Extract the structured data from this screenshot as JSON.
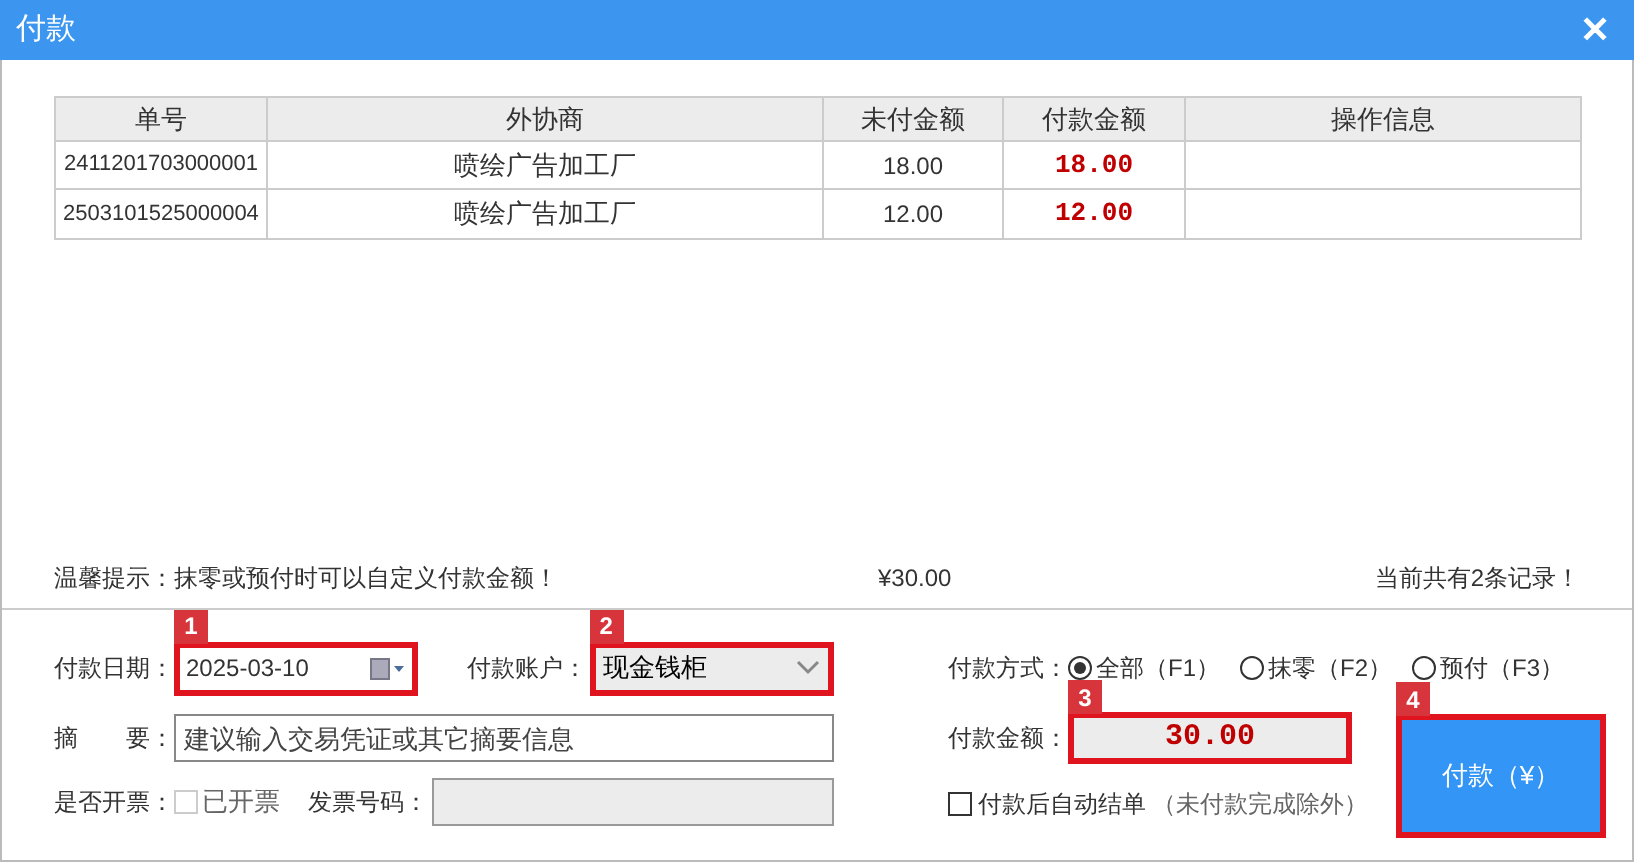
{
  "window": {
    "title": "付款",
    "close": "✕"
  },
  "table": {
    "columns": [
      "单号",
      "外协商",
      "未付金额",
      "付款金额",
      "操作信息"
    ],
    "rows": [
      {
        "cells": [
          "2411201703000001",
          "喷绘广告加工厂",
          "18.00",
          "18.00",
          ""
        ]
      },
      {
        "cells": [
          "2503101525000004",
          "喷绘广告加工厂",
          "12.00",
          "12.00",
          ""
        ]
      }
    ]
  },
  "summary": {
    "hint": "温馨提示：抹零或预付时可以自定义付款金额！",
    "total": "¥30.00",
    "count": "当前共有2条记录！"
  },
  "form": {
    "date_label": "付款日期：",
    "date": "2025-03-10",
    "account_label": "付款账户：",
    "account": "现金钱柜",
    "memo_label": "摘　　要：",
    "memo_placeholder": "建议输入交易凭证或其它摘要信息",
    "invoice_label": "是否开票：",
    "invoiced_label": "已开票",
    "invoiced": false,
    "invoice_no_label": "发票号码：",
    "method_label": "付款方式：",
    "methods": [
      {
        "label": "全部（F1）",
        "selected": true
      },
      {
        "label": "抹零（F2）",
        "selected": false
      },
      {
        "label": "预付（F3）",
        "selected": false
      }
    ],
    "amount_label": "付款金额：",
    "amount": "30.00",
    "auto_close_label": "付款后自动结单",
    "auto_close_note": "（未付款完成除外）",
    "auto_close": false,
    "pay_button": "付款（¥）"
  },
  "callouts": [
    "1",
    "2",
    "3",
    "4"
  ]
}
